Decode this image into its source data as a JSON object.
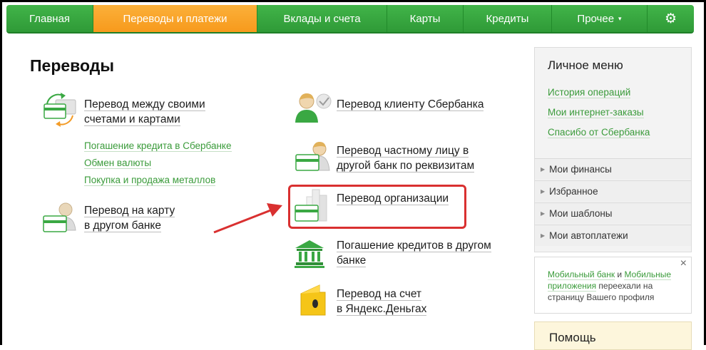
{
  "nav": {
    "items": [
      {
        "label": "Главная"
      },
      {
        "label": "Переводы и платежи"
      },
      {
        "label": "Вклады и счета"
      },
      {
        "label": "Карты"
      },
      {
        "label": "Кредиты"
      },
      {
        "label": "Прочее"
      }
    ],
    "active_index": 1,
    "more_caret": "▾",
    "settings_icon": "gear-icon"
  },
  "main": {
    "title": "Переводы",
    "left": {
      "own_accounts": {
        "line1": "Перевод между своими",
        "line2": "счетами и картами"
      },
      "sub_links": [
        "Погашение кредита в Сбербанке",
        "Обмен валюты",
        "Покупка и продажа металлов"
      ],
      "card_other_bank": {
        "line1": "Перевод на карту",
        "line2": "в другом банке"
      }
    },
    "right": {
      "sber_client": "Перевод клиенту Сбербанка",
      "private_person": {
        "line1": "Перевод частному лицу в",
        "line2": "другой банк по реквизитам"
      },
      "organization": "Перевод организации",
      "other_bank_credit": {
        "line1": "Погашение кредитов в другом",
        "line2": "банке"
      },
      "yandex": {
        "line1": "Перевод на счет",
        "line2": "в Яндекс.Деньгах"
      }
    }
  },
  "sidebar": {
    "title": "Личное меню",
    "links": [
      "История операций",
      "Мои интернет-заказы",
      "Спасибо от Сбербанка"
    ],
    "rows": [
      "Мои финансы",
      "Избранное",
      "Мои шаблоны",
      "Мои автоплатежи"
    ],
    "info": {
      "link1": "Мобильный банк",
      "and": " и ",
      "link2": "Мобильные приложения",
      "rest": " переехали на страницу Вашего профиля",
      "close": "×"
    },
    "help_title": "Помощь"
  },
  "colors": {
    "nav_green": "#3aa843",
    "nav_active_orange": "#f9a52b",
    "link_green": "#3a9b3a",
    "highlight_red": "#d93030"
  }
}
